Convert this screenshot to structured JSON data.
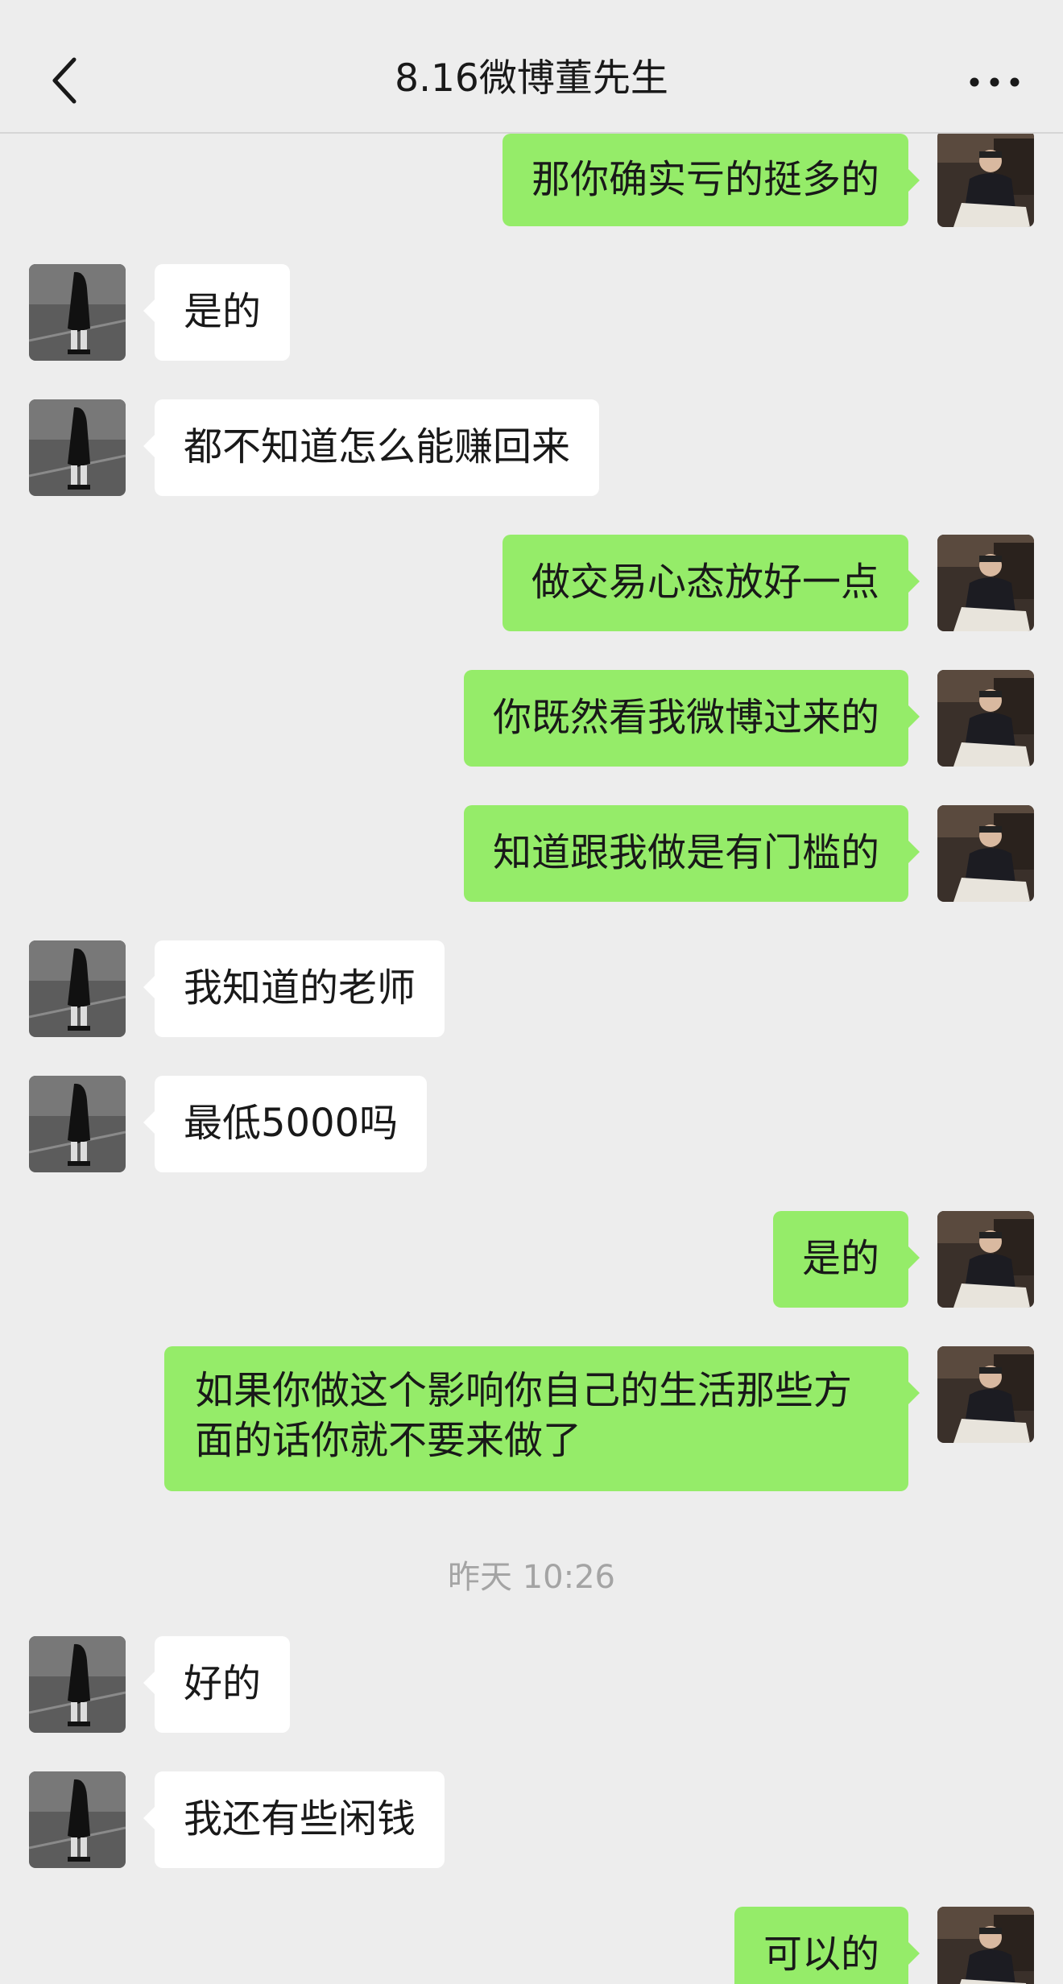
{
  "header": {
    "title": "8.16微博董先生",
    "back_icon": "chevron-left-icon",
    "more_icon": "more-dots-icon"
  },
  "colors": {
    "background": "#ededed",
    "sent_bubble": "#95ec69",
    "received_bubble": "#ffffff",
    "timestamp_text": "#a4a4a4"
  },
  "messages": [
    {
      "side": "right",
      "text": "那你确实亏的挺多的"
    },
    {
      "side": "left",
      "text": "是的"
    },
    {
      "side": "left",
      "text": "都不知道怎么能赚回来"
    },
    {
      "side": "right",
      "text": "做交易心态放好一点"
    },
    {
      "side": "right",
      "text": "你既然看我微博过来的"
    },
    {
      "side": "right",
      "text": "知道跟我做是有门槛的"
    },
    {
      "side": "left",
      "text": "我知道的老师"
    },
    {
      "side": "left",
      "text": "最低5000吗"
    },
    {
      "side": "right",
      "text": "是的"
    },
    {
      "side": "right",
      "text": "如果你做这个影响你自己的生活那些方面的话你就不要来做了"
    },
    {
      "side": "left",
      "text": "好的"
    },
    {
      "side": "left",
      "text": "我还有些闲钱"
    },
    {
      "side": "right",
      "text": "可以的"
    }
  ],
  "timestamp": "昨天 10:26"
}
